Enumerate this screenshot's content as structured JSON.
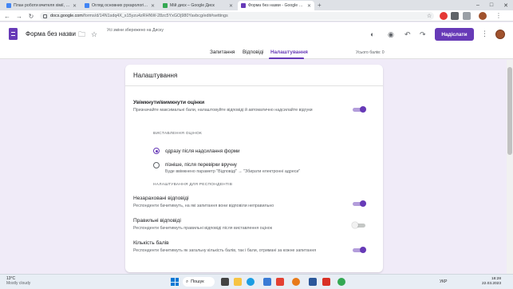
{
  "browser": {
    "tabs": [
      {
        "title": "План роботи вчителя хімії, біол",
        "favicon": "#4285f4"
      },
      {
        "title": "Огляд основних рукарологічних",
        "favicon": "#4285f4"
      },
      {
        "title": "Мій диск – Google Диск",
        "favicon": "#34a853"
      },
      {
        "title": "Форма без назви - Google Форм",
        "favicon": "#673ab7"
      }
    ],
    "active_tab": 3,
    "new_tab": "+",
    "minimize": "–",
    "maximize": "□",
    "close": "✕",
    "url_host": "docs.google.com",
    "url_path": "/forms/d/14N1sdq4X_s15yzu4zRHNW-28zc5YxGOj980Yavbcg/edit#settings",
    "back": "←",
    "forward": "→",
    "reload": "↻",
    "star": "☆"
  },
  "forms_header": {
    "title": "Форма без назви",
    "saved_status": "Усі зміни збережено на Диску",
    "send_label": "Надіслати",
    "folder_icon": "🗀",
    "star_icon": "☆",
    "palette_icon": "◐",
    "preview_icon": "◉",
    "undo_icon": "↶",
    "redo_icon": "↷",
    "more_icon": "⋮"
  },
  "form_tabs": {
    "questions": "Запитання",
    "responses": "Відповіді",
    "settings": "Налаштування",
    "total_points": "Усього балів: 0"
  },
  "settings_card": {
    "title": "Налаштування",
    "quiz": {
      "title": "Увімкнути/вимкнути оцінки",
      "desc": "Призначайте максимальні бали, налаштовуйте відповіді й автоматично надсилайте відгуки",
      "enabled": true
    },
    "release_section": "ВИСТАВЛЕННЯ ОЦІНОК",
    "release_options": [
      {
        "label": "одразу після надсилання форми",
        "sub": "",
        "selected": true
      },
      {
        "label": "пізніше, після перевірки вручну",
        "sub": "Буде ввімкнено параметр \"Відповіді\" → \"Збирати електронні адреси\"",
        "selected": false
      }
    ],
    "respondent_section": "НАЛАШТУВАННЯ ДЛЯ РЕСПОНДЕНТІВ",
    "respondent_settings": [
      {
        "title": "Незараховані відповіді",
        "desc": "Респонденти бачитимуть, на які запитання вони відповіли неправильно",
        "enabled": true
      },
      {
        "title": "Правильні відповіді",
        "desc": "Респонденти бачитимуть правильні відповіді після виставлення оцінок",
        "enabled": false
      },
      {
        "title": "Кількість балів",
        "desc": "Респонденти бачитимуть як загальну кількість балів, так і бали, отримані за кожне запитання",
        "enabled": true
      }
    ]
  },
  "taskbar": {
    "weather_temp": "13°C",
    "weather_desc": "Mostly cloudy",
    "search_label": "Пошук",
    "search_icon": "⌕",
    "language": "УКР",
    "time": "18:28",
    "date": "22.03.2023",
    "apps": [
      {
        "name": "task-view",
        "color": "#444"
      },
      {
        "name": "file-explorer",
        "color": "#f6c343"
      },
      {
        "name": "edge",
        "color": "#1b9de2"
      },
      {
        "name": "store",
        "color": "#3a7bd5"
      },
      {
        "name": "app-red",
        "color": "#e34133"
      },
      {
        "name": "app-blue",
        "color": "#2b579a"
      },
      {
        "name": "app-yellow",
        "color": "#f4b400"
      },
      {
        "name": "app-orange",
        "color": "#e87a1a"
      },
      {
        "name": "app-red2",
        "color": "#d93025"
      },
      {
        "name": "chrome",
        "color": "#34a853"
      }
    ]
  },
  "colors": {
    "accent": "#673ab7",
    "page_bg": "#f0ebf8"
  }
}
